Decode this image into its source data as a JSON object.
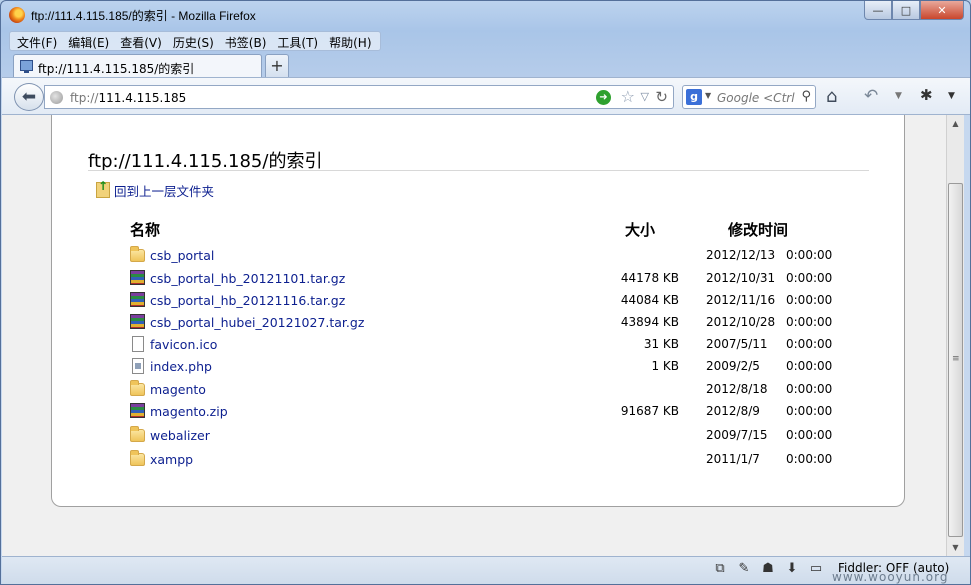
{
  "window": {
    "title": "ftp://111.4.115.185/的索引 - Mozilla Firefox",
    "buttons": [
      "—",
      "□",
      "✕"
    ]
  },
  "menu": [
    "文件(F)",
    "编辑(E)",
    "查看(V)",
    "历史(S)",
    "书签(B)",
    "工具(T)",
    "帮助(H)"
  ],
  "tab": {
    "label": "ftp://111.4.115.185/的索引",
    "new_tab": "+"
  },
  "navbar": {
    "url_prefix": "ftp://",
    "url_host": "111.4.115.185",
    "search_placeholder": "Google <Ctrl"
  },
  "page": {
    "title": "ftp://111.4.115.185/的索引",
    "up_link": "回到上一层文件夹",
    "columns": {
      "name": "名称",
      "size": "大小",
      "modified": "修改时间"
    },
    "files": [
      {
        "icon": "folder",
        "name": "csb_portal",
        "size": "",
        "date": "2012/12/13",
        "time": "0:00:00"
      },
      {
        "icon": "archive",
        "name": "csb_portal_hb_20121101.tar.gz",
        "size": "44178 KB",
        "date": "2012/10/31",
        "time": "0:00:00"
      },
      {
        "icon": "archive",
        "name": "csb_portal_hb_20121116.tar.gz",
        "size": "44084 KB",
        "date": "2012/11/16",
        "time": "0:00:00"
      },
      {
        "icon": "archive",
        "name": "csb_portal_hubei_20121027.tar.gz",
        "size": "43894 KB",
        "date": "2012/10/28",
        "time": "0:00:00"
      },
      {
        "icon": "doc",
        "name": "favicon.ico",
        "size": "31 KB",
        "date": "2007/5/11",
        "time": "0:00:00"
      },
      {
        "icon": "php",
        "name": "index.php",
        "size": "1 KB",
        "date": "2009/2/5",
        "time": "0:00:00"
      },
      {
        "icon": "folder",
        "name": "magento",
        "size": "",
        "date": "2012/8/18",
        "time": "0:00:00"
      },
      {
        "icon": "archive",
        "name": "magento.zip",
        "size": "91687 KB",
        "date": "2012/8/9",
        "time": "0:00:00"
      },
      {
        "icon": "folder",
        "name": "webalizer",
        "size": "",
        "date": "2009/7/15",
        "time": "0:00:00"
      },
      {
        "icon": "folder",
        "name": "xampp",
        "size": "",
        "date": "2011/1/7",
        "time": "0:00:00"
      }
    ]
  },
  "statusbar": {
    "fiddler": "Fiddler: OFF (auto)"
  },
  "watermark": "www.wooyun.org"
}
